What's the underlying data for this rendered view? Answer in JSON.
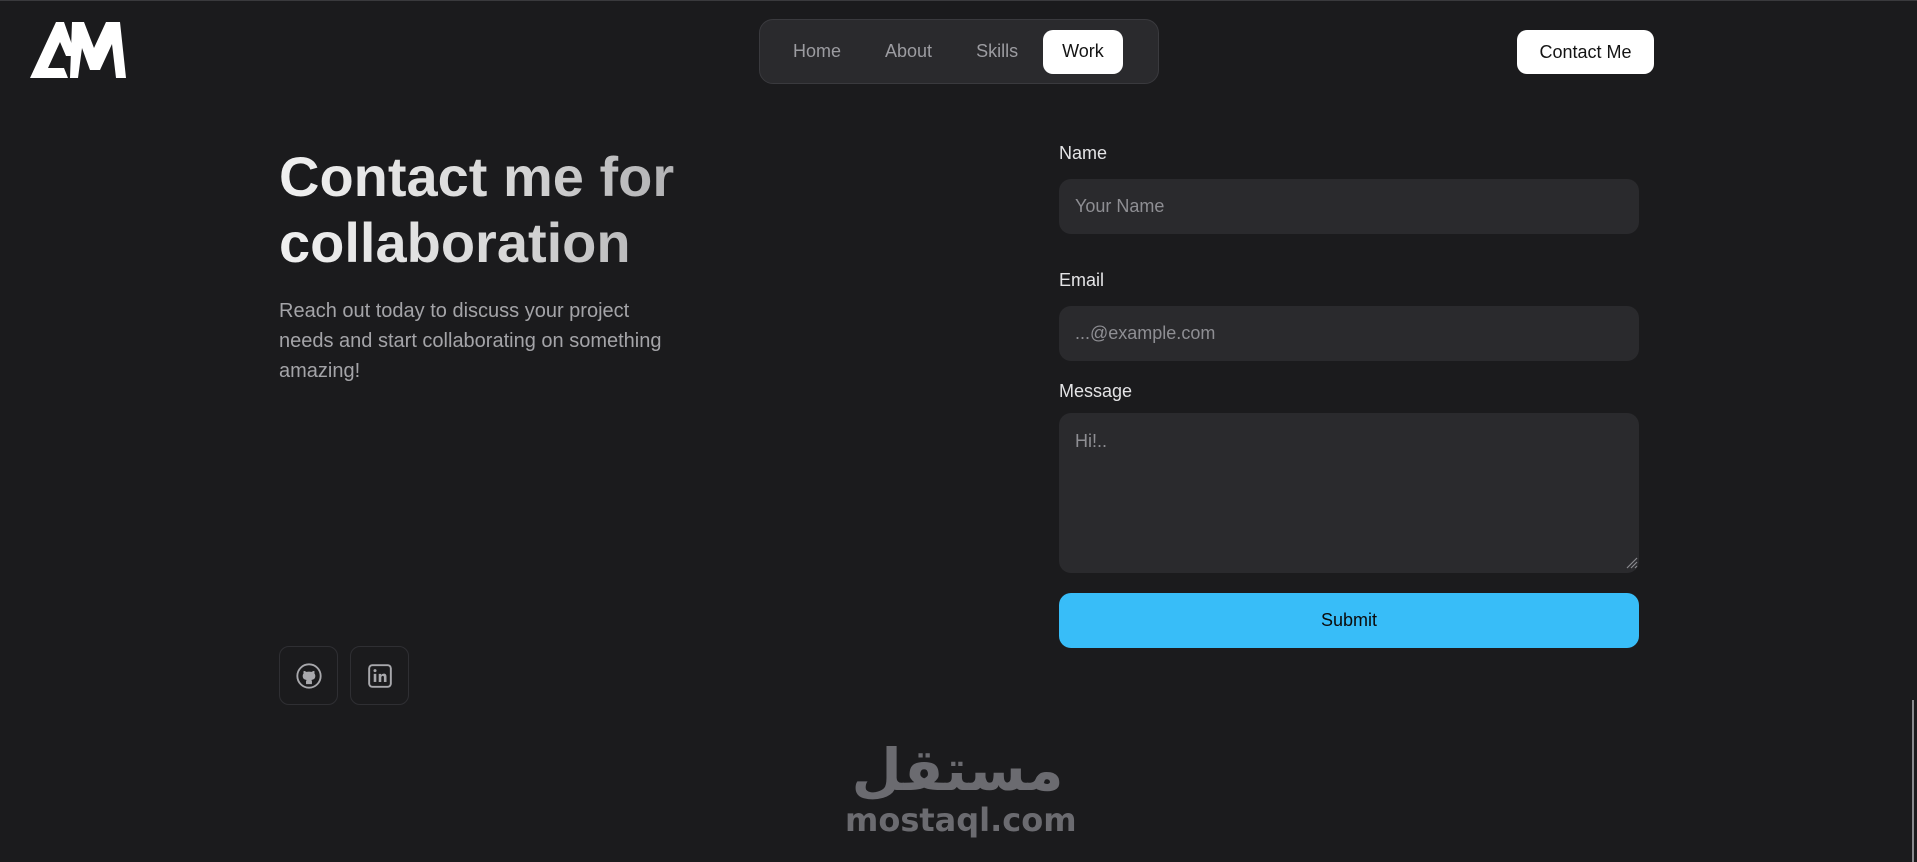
{
  "brand": {
    "logo_text": "AM"
  },
  "nav": {
    "items": [
      {
        "label": "Home",
        "active": false
      },
      {
        "label": "About",
        "active": false
      },
      {
        "label": "Skills",
        "active": false
      },
      {
        "label": "Work",
        "active": true
      }
    ]
  },
  "header": {
    "contact_label": "Contact Me"
  },
  "hero": {
    "title_line1": "Contact me for",
    "title_line2": "collaboration",
    "subtitle": "Reach out today to discuss your project needs and start collaborating on something amazing!"
  },
  "form": {
    "name_label": "Name",
    "name_placeholder": "Your Name",
    "email_label": "Email",
    "email_placeholder": "...@example.com",
    "message_label": "Message",
    "message_placeholder": "Hi!..",
    "submit_label": "Submit"
  },
  "socials": [
    {
      "icon": "github-icon"
    },
    {
      "icon": "linkedin-icon"
    }
  ],
  "watermark": {
    "arabic": "مستقل",
    "latin": "mostaql.com"
  },
  "colors": {
    "background": "#1b1b1d",
    "accent": "#38bdf8",
    "field_bg": "#2a2a2d",
    "nav_bg": "#2a2a2d"
  }
}
